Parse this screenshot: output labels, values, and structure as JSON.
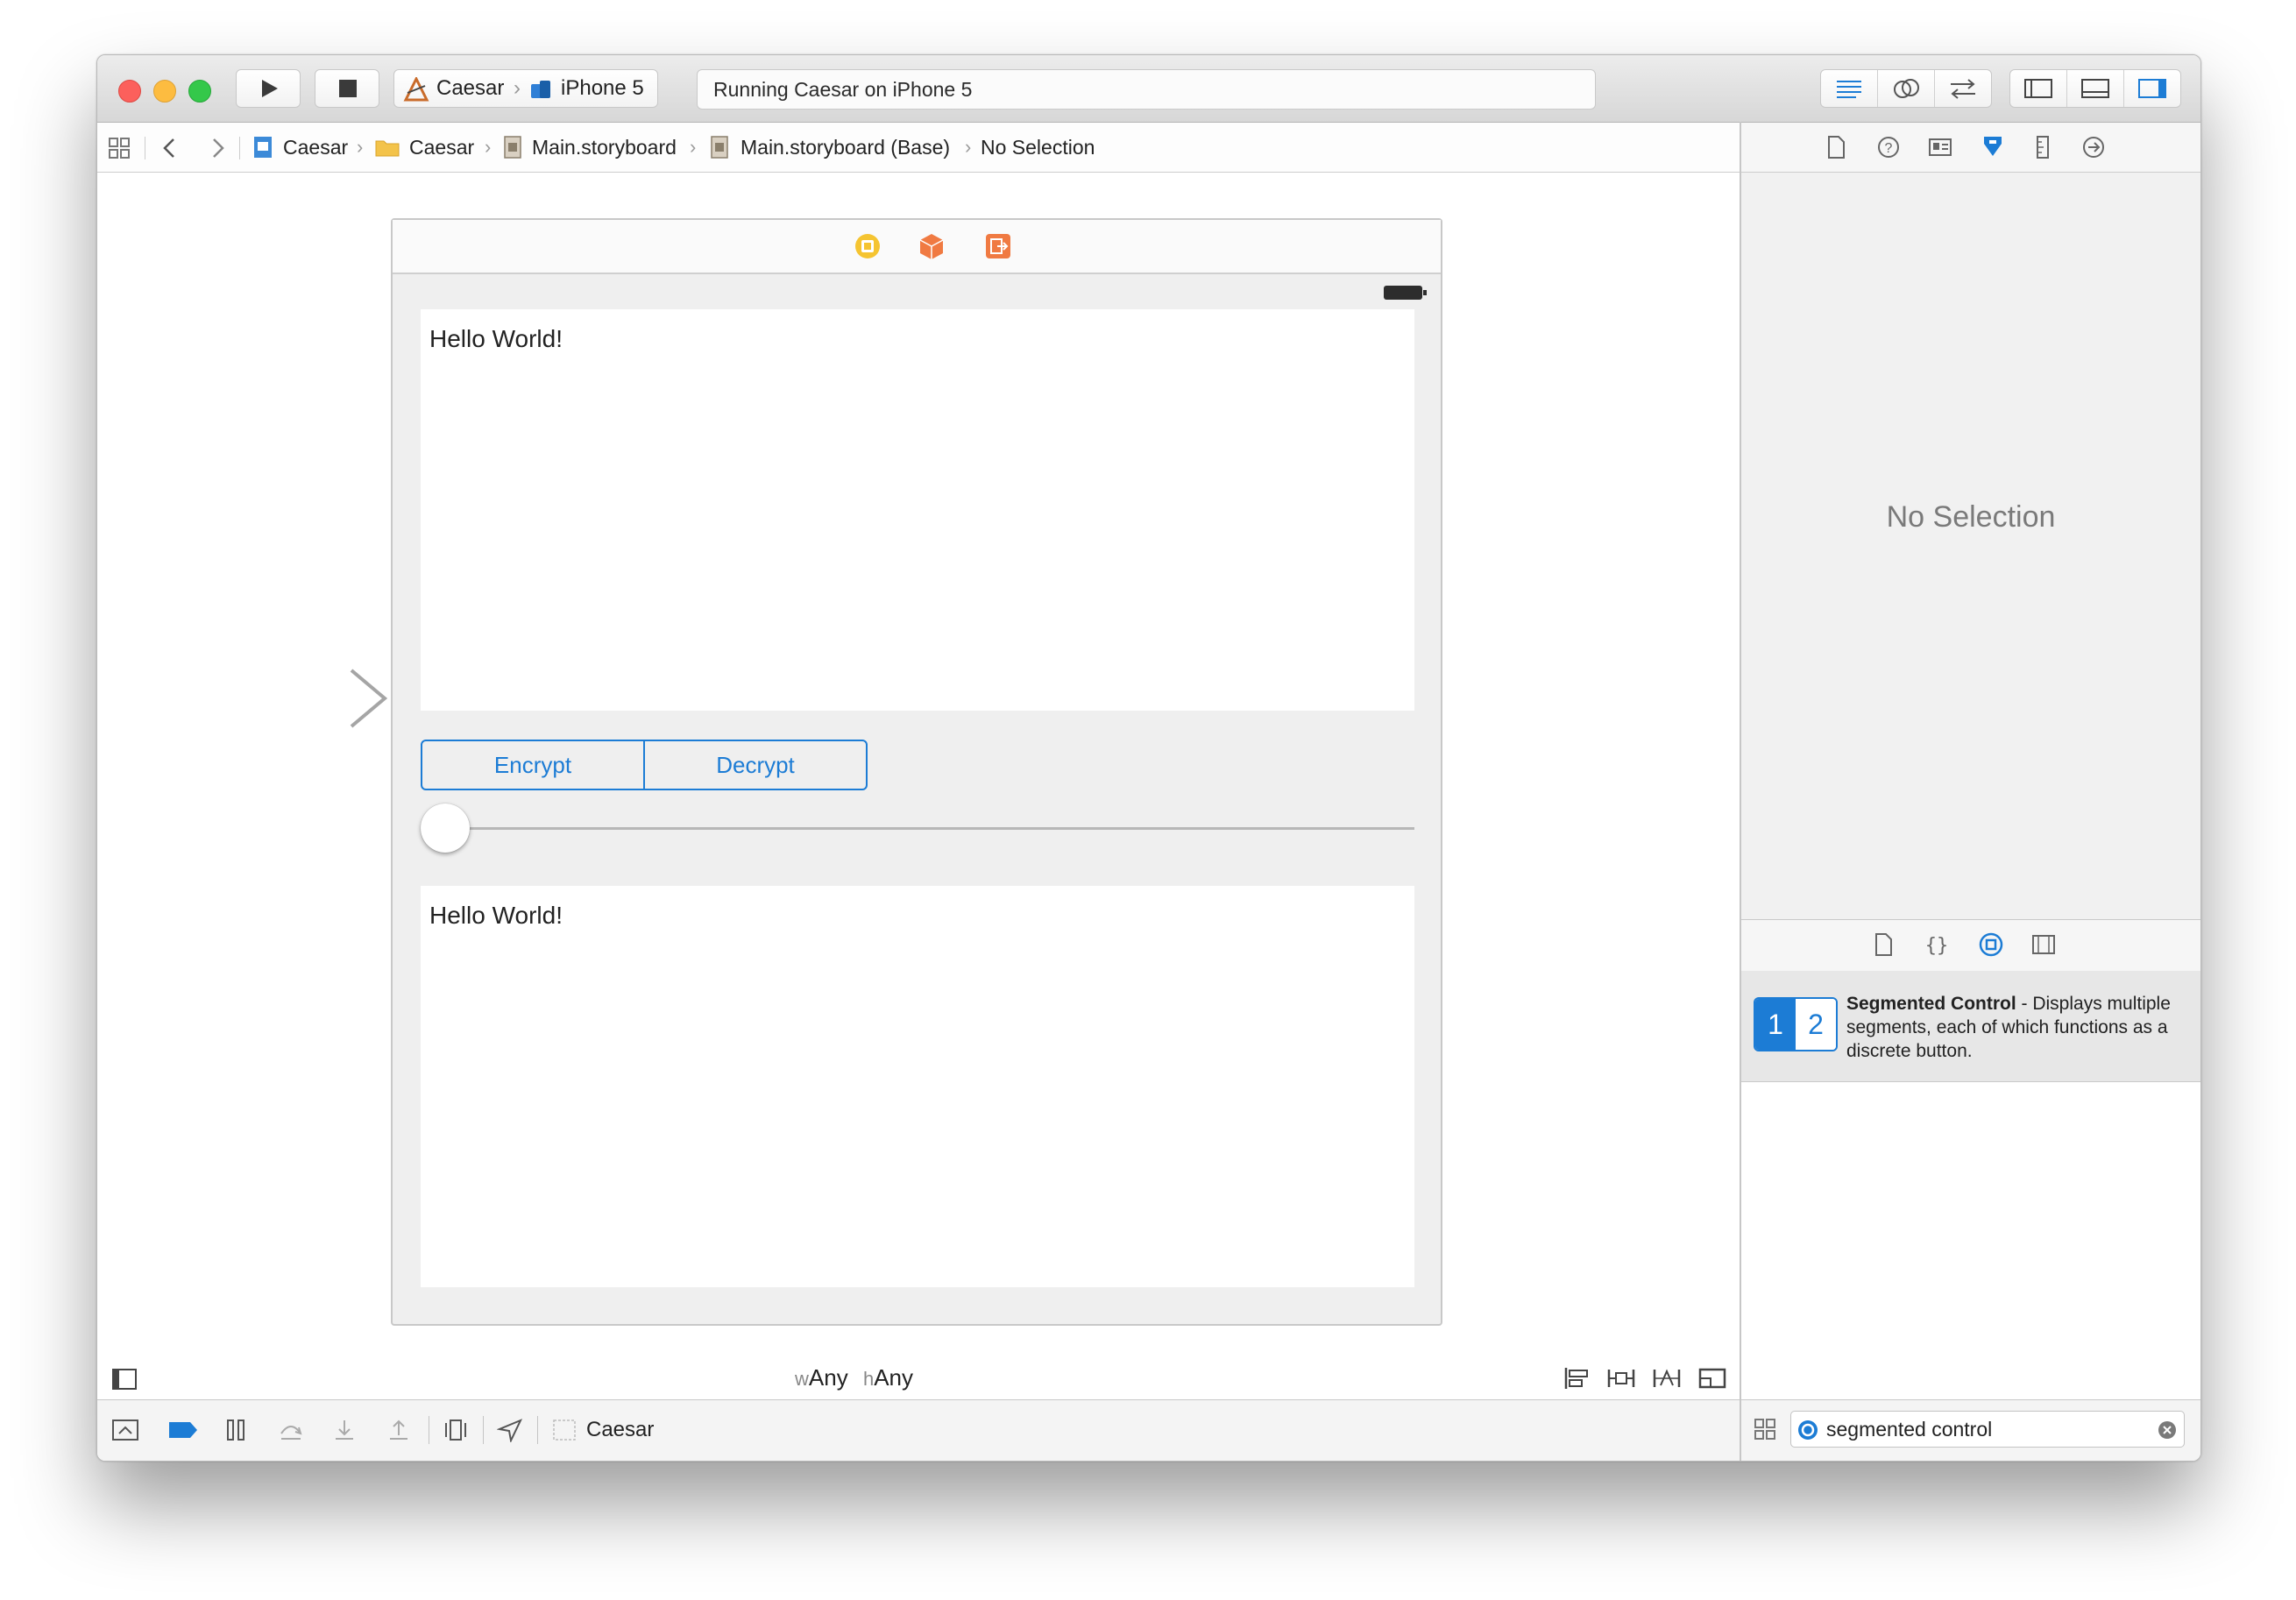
{
  "toolbar": {
    "scheme": {
      "app": "Caesar",
      "device": "iPhone 5"
    },
    "activity_status": "Running Caesar on iPhone 5"
  },
  "jumpbar": {
    "crumbs": [
      "Caesar",
      "Caesar",
      "Main.storyboard",
      "Main.storyboard (Base)",
      "No Selection"
    ]
  },
  "scene": {
    "top_text": "Hello World!",
    "segments": [
      "Encrypt",
      "Decrypt"
    ],
    "slider_value": 0,
    "bottom_text": "Hello World!"
  },
  "canvas_footer": {
    "w_prefix": "w",
    "w_value": "Any",
    "h_prefix": "h",
    "h_value": "Any"
  },
  "debug_bar": {
    "target": "Caesar"
  },
  "inspector": {
    "empty_message": "No Selection"
  },
  "library": {
    "item": {
      "icon_segments": [
        "1",
        "2"
      ],
      "title": "Segmented Control",
      "description": " - Displays multiple segments, each of which functions as a discrete button."
    },
    "filter_value": "segmented control"
  },
  "colors": {
    "accent": "#1c7cd5",
    "close": "#fc605c",
    "minimize": "#fdbc40",
    "zoom": "#34c84a"
  }
}
